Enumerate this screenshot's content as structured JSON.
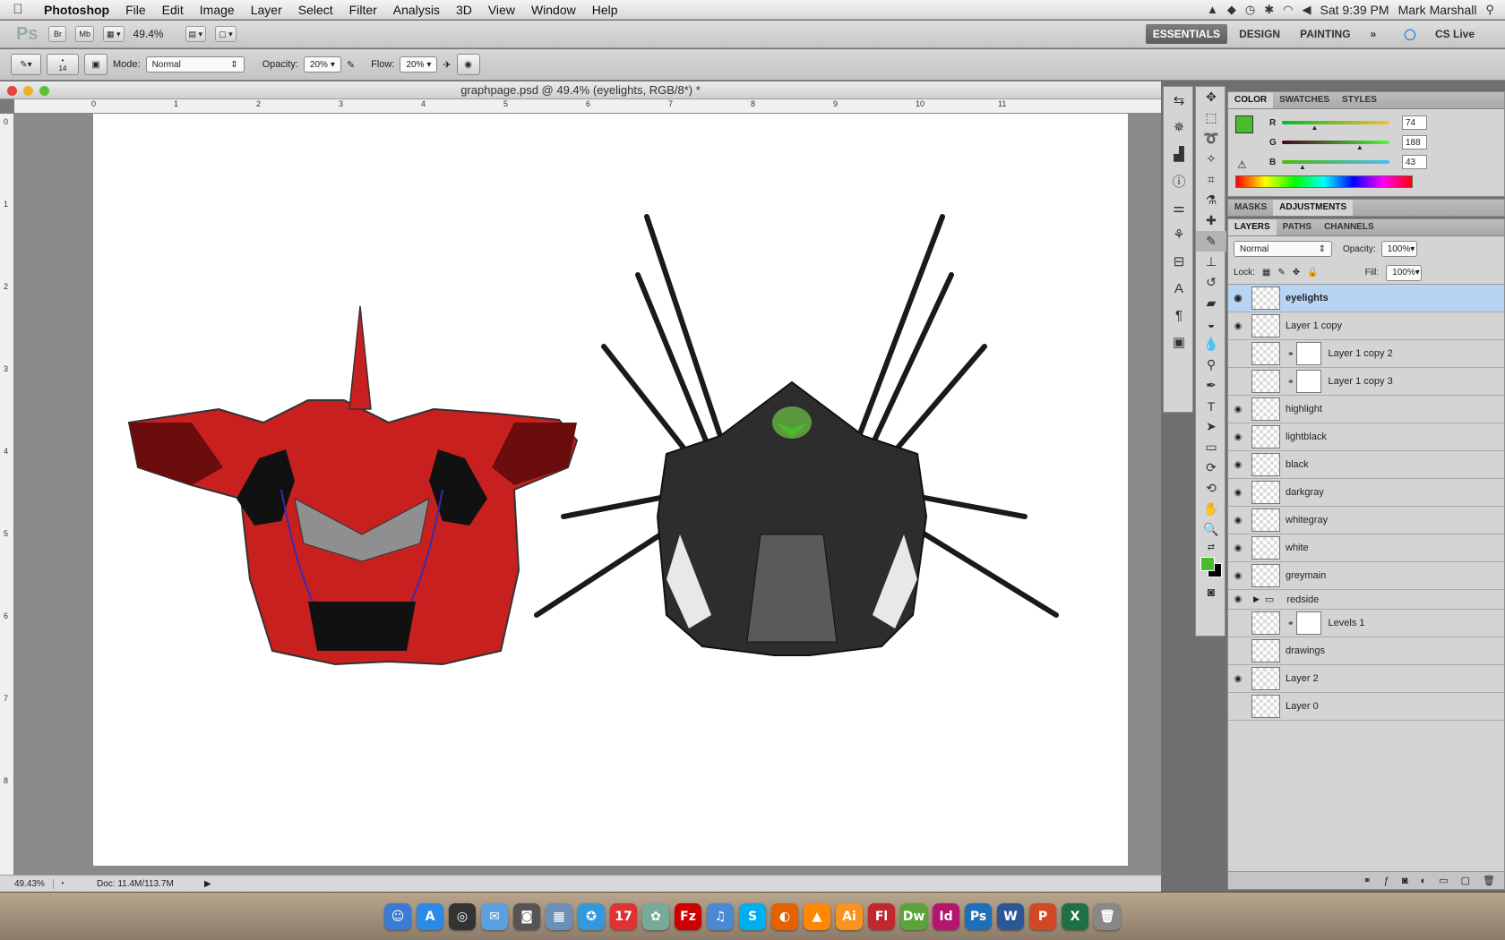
{
  "menubar": {
    "app": "Photoshop",
    "items": [
      "File",
      "Edit",
      "Image",
      "Layer",
      "Select",
      "Filter",
      "Analysis",
      "3D",
      "View",
      "Window",
      "Help"
    ],
    "clock": "Sat 9:39 PM",
    "user": "Mark Marshall"
  },
  "appbar": {
    "logo": "Ps",
    "bridge": "Br",
    "minibridge": "Mb",
    "zoom": "49.4%",
    "workspaces": [
      "ESSENTIALS",
      "DESIGN",
      "PAINTING"
    ],
    "more": "»",
    "cslive": "CS Live"
  },
  "options": {
    "brush_size": "14",
    "mode_label": "Mode:",
    "mode_value": "Normal",
    "opacity_label": "Opacity:",
    "opacity_value": "20%",
    "flow_label": "Flow:",
    "flow_value": "20%"
  },
  "document": {
    "title": "graphpage.psd @ 49.4% (eyelights, RGB/8*) *",
    "zoom": "49.43%",
    "docsize": "Doc: 11.4M/113.7M",
    "ruler_h": [
      "0",
      "1",
      "2",
      "3",
      "4",
      "5",
      "6",
      "7",
      "8",
      "9",
      "10",
      "11"
    ],
    "ruler_v": [
      "0",
      "1",
      "2",
      "3",
      "4",
      "5",
      "6",
      "7",
      "8"
    ]
  },
  "color_panel": {
    "tabs": [
      "COLOR",
      "SWATCHES",
      "STYLES"
    ],
    "fg_color": "#4abc2b",
    "r": {
      "label": "R",
      "value": "74",
      "level": 0.29
    },
    "g": {
      "label": "G",
      "value": "188",
      "level": 0.74
    },
    "b": {
      "label": "B",
      "value": "43",
      "level": 0.17
    }
  },
  "adjust_panel": {
    "tabs": [
      "MASKS",
      "ADJUSTMENTS"
    ]
  },
  "layers_panel": {
    "tabs": [
      "LAYERS",
      "PATHS",
      "CHANNELS"
    ],
    "blend": "Normal",
    "opacity_label": "Opacity:",
    "opacity": "100%",
    "lock_label": "Lock:",
    "fill_label": "Fill:",
    "fill": "100%",
    "layers": [
      {
        "name": "eyelights",
        "visible": true,
        "active": true,
        "mask": false
      },
      {
        "name": "Layer 1 copy",
        "visible": true,
        "active": false,
        "mask": false
      },
      {
        "name": "Layer 1 copy 2",
        "visible": false,
        "active": false,
        "mask": true
      },
      {
        "name": "Layer 1 copy 3",
        "visible": false,
        "active": false,
        "mask": true
      },
      {
        "name": "highlight",
        "visible": true,
        "active": false,
        "mask": false
      },
      {
        "name": "lightblack",
        "visible": true,
        "active": false,
        "mask": false
      },
      {
        "name": "black",
        "visible": true,
        "active": false,
        "mask": false
      },
      {
        "name": "darkgray",
        "visible": true,
        "active": false,
        "mask": false
      },
      {
        "name": "whitegray",
        "visible": true,
        "active": false,
        "mask": false
      },
      {
        "name": "white",
        "visible": true,
        "active": false,
        "mask": false
      },
      {
        "name": "greymain",
        "visible": true,
        "active": false,
        "mask": false
      },
      {
        "name": "redside",
        "visible": true,
        "active": false,
        "mask": false,
        "group": true
      },
      {
        "name": "Levels 1",
        "visible": false,
        "active": false,
        "mask": true
      },
      {
        "name": "drawings",
        "visible": false,
        "active": false,
        "mask": false
      },
      {
        "name": "Layer 2",
        "visible": true,
        "active": false,
        "mask": false
      },
      {
        "name": "Layer 0",
        "visible": false,
        "active": false,
        "mask": false
      }
    ]
  },
  "dock": {
    "icons": [
      {
        "name": "finder-icon",
        "glyph": "☺",
        "color": "#3a7bd5"
      },
      {
        "name": "appstore-icon",
        "glyph": "A",
        "color": "#2a8ae6"
      },
      {
        "name": "dashboard-icon",
        "glyph": "◎",
        "color": "#333"
      },
      {
        "name": "ichat-icon",
        "glyph": "✉",
        "color": "#5aa0e0"
      },
      {
        "name": "facetime-icon",
        "glyph": "◙",
        "color": "#555"
      },
      {
        "name": "preview-icon",
        "glyph": "▦",
        "color": "#6b8fb8"
      },
      {
        "name": "safari-icon",
        "glyph": "✪",
        "color": "#3399dd"
      },
      {
        "name": "ical-icon",
        "glyph": "17",
        "color": "#d33"
      },
      {
        "name": "iphoto-icon",
        "glyph": "✿",
        "color": "#7a9"
      },
      {
        "name": "filezilla-icon",
        "glyph": "Fz",
        "color": "#c00"
      },
      {
        "name": "itunes-icon",
        "glyph": "♫",
        "color": "#4a8ad4"
      },
      {
        "name": "skype-icon",
        "glyph": "S",
        "color": "#00aff0"
      },
      {
        "name": "firefox-icon",
        "glyph": "◐",
        "color": "#e66000"
      },
      {
        "name": "vlc-icon",
        "glyph": "▲",
        "color": "#f80"
      },
      {
        "name": "illustrator-icon",
        "glyph": "Ai",
        "color": "#f7931e"
      },
      {
        "name": "flash-icon",
        "glyph": "Fl",
        "color": "#c1272d"
      },
      {
        "name": "dreamweaver-icon",
        "glyph": "Dw",
        "color": "#5ba33b"
      },
      {
        "name": "indesign-icon",
        "glyph": "Id",
        "color": "#b5156f"
      },
      {
        "name": "photoshop-icon",
        "glyph": "Ps",
        "color": "#1d6fb8"
      },
      {
        "name": "word-icon",
        "glyph": "W",
        "color": "#2b5797"
      },
      {
        "name": "powerpoint-icon",
        "glyph": "P",
        "color": "#d24726"
      },
      {
        "name": "excel-icon",
        "glyph": "X",
        "color": "#1e7145"
      },
      {
        "name": "trash-icon",
        "glyph": "🗑",
        "color": "#888"
      }
    ]
  }
}
